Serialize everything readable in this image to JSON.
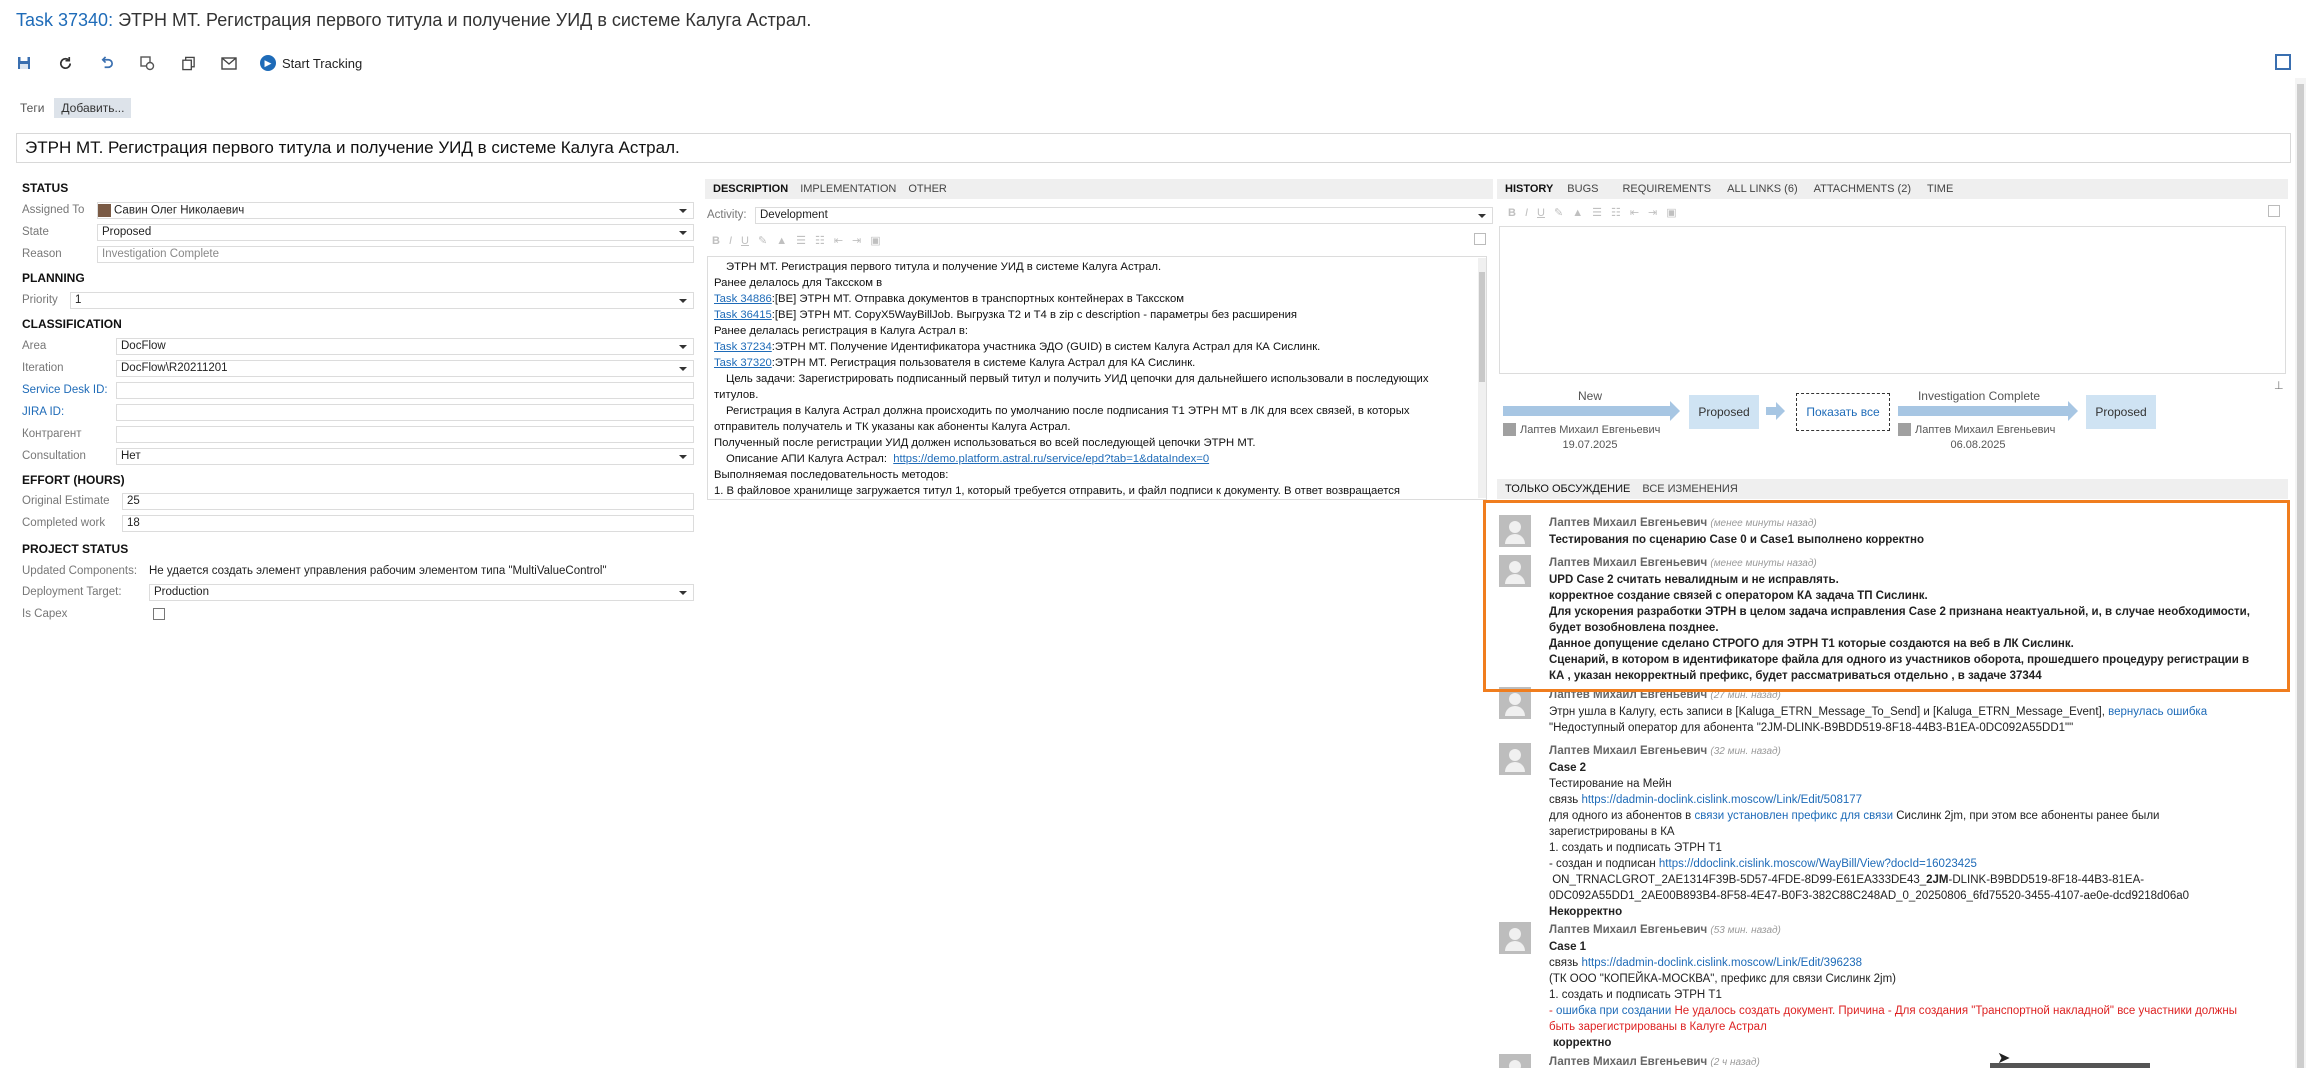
{
  "title": {
    "id": "Task 37340:",
    "text": "ЭТРН МТ. Регистрация первого титула и получение УИД в системе Калуга Астрал."
  },
  "toolbar": {
    "start_tracking": "Start Tracking"
  },
  "tags": {
    "label": "Теги",
    "add": "Добавить..."
  },
  "work_item_title": "ЭТРН МТ. Регистрация первого титула и получение УИД в системе Калуга Астрал.",
  "status": {
    "heading": "STATUS",
    "assigned_to_label": "Assigned To",
    "assigned_to": "Савин Олег Николаевич",
    "state_label": "State",
    "state": "Proposed",
    "reason_label": "Reason",
    "reason": "Investigation Complete"
  },
  "planning": {
    "heading": "PLANNING",
    "priority_label": "Priority",
    "priority": "1"
  },
  "classification": {
    "heading": "CLASSIFICATION",
    "area_label": "Area",
    "area": "DocFlow",
    "iteration_label": "Iteration",
    "iteration": "DocFlow\\R20211201",
    "service_desk_label": "Service Desk ID:",
    "service_desk": "",
    "jira_label": "JIRA ID:",
    "jira": "",
    "counterparty_label": "Контрагент",
    "counterparty": "",
    "consultation_label": "Consultation",
    "consultation": "Нет"
  },
  "effort": {
    "heading": "EFFORT (HOURS)",
    "original_label": "Original Estimate",
    "original": "25",
    "completed_label": "Completed work",
    "completed": "18"
  },
  "project_status": {
    "heading": "PROJECT STATUS",
    "updated_label": "Updated Components:",
    "updated": "Не удается создать элемент управления рабочим элементом типа \"MultiValueControl\"",
    "deployment_label": "Deployment Target:",
    "deployment": "Production",
    "capex_label": "Is Capex"
  },
  "desc_tabs": [
    "DESCRIPTION",
    "IMPLEMENTATION",
    "OTHER"
  ],
  "activity": {
    "label": "Activity:",
    "value": "Development"
  },
  "description": {
    "l1": "ЭТРН МТ. Регистрация первого титула и получение УИД в системе Калуга Астрал.",
    "l2": "Ранее делалось для Таксском в",
    "l3_link": "Task 34886",
    "l3": ":[ВЕ] ЭТРН МТ. Отправка документов в транспортных контейнерах в Таксском",
    "l4_link": "Task 36415",
    "l4": ":[ВЕ] ЭТРН МТ. CopyX5WayBillJob. Выгрузка Т2 и Т4 в zip с description - параметры без расширения",
    "l5": "Ранее делалась регистрация в Калуга Астрал в:",
    "l6_link": "Task 37234",
    "l6": ":ЭТРН МТ. Получение Идентификатора участника ЭДО (GUID) в систем Калуга Астрал для КА Сислинк.",
    "l7_link": "Task 37320",
    "l7": ":ЭТРН МТ. Регистрация пользователя в системе Калуга Астрал для КА Сислинк.",
    "l8": "Цель задачи: Зарегистрировать подписанный первый титул и получить УИД цепочки для дальнейшего использовали в последующих",
    "l9": "титулов.",
    "l10": "Регистрация в Калуга Астрал должна происходить по умолчанию после подписания Т1 ЭТРН МТ в ЛК для всех связей, в которых",
    "l11": "отправитель получатель и ТК указаны как абоненты Калуга Астрал.",
    "l12": "Полученный после регистрации УИД должен использоваться во всей последующей цепочки ЭТРН МТ.",
    "l13": "Описание АПИ Калуга Астрал:",
    "l13_link": "https://demo.platform.astral.ru/service/epd?tab=1&dataIndex=0",
    "l14": "Выполняемая последовательность методов:",
    "l15": "1. В файловое хранилище загружается титул 1, который требуется отправить, и файл подписи к документу. В ответ возвращается"
  },
  "right_tabs": [
    "HISTORY",
    "BUGS",
    "REQUIREMENTS",
    "ALL LINKS (6)",
    "ATTACHMENTS (2)",
    "TIME"
  ],
  "workflow": {
    "s1_label": "New",
    "s1_user": "Лаптев Михаил Евгеньевич",
    "s1_date": "19.07.2025",
    "box1": "Proposed",
    "show_all": "Показать все",
    "s2_label": "Investigation Complete",
    "s2_user": "Лаптев Михаил Евгеньевич",
    "s2_date": "06.08.2025",
    "box2": "Proposed"
  },
  "disc_tabs": [
    "ТОЛЬКО ОБСУЖДЕНИЕ",
    "ВСЕ ИЗМЕНЕНИЯ"
  ],
  "comments": {
    "author": "Лаптев Михаил Евгеньевич",
    "c1_time": "(менее минуты назад)",
    "c1": "Тестирования по сценарию Case 0 и Case1 выполнено корректно",
    "c2_time": "(менее минуты назад)",
    "c2_l1": "UPD Case 2 считать невалидным и не исправлять.",
    "c2_l2": "корректное создание связей с оператором КА задача ТП Сислинк.",
    "c2_l3": "Для ускорения разработки ЭТРН в целом задача исправления Case 2 признана неактуальной, и, в случае необходимости,",
    "c2_l4": "будет возобновлена позднее.",
    "c2_l5": "Данное допущение сделано СТРОГО для ЭТРН Т1 которые создаются на веб в ЛК Сислинк.",
    "c2_l6": "Сценарий, в котором в идентификаторе файла для одного из участников оборота, прошедшего процедуру регистрации в",
    "c2_l7": "КА , указан некорректный префикс, будет рассматриваться отдельно , в задаче 37344",
    "c3_time": "(27 мин. назад)",
    "c3_l1": "Этрн ушла в Калугу, есть записи в [Kaluga_ETRN_Message_To_Send] и [Kaluga_ETRN_Message_Event],",
    "c3_l1_link": "вернулась ошибка",
    "c3_l2": "\"Недоступный оператор для абонента \"2JM-DLINK-B9BDD519-8F18-44B3-B1EA-0DC092A55DD1\"\"",
    "c4_time": "(32 мин. назад)",
    "c4_l1": "Case 2",
    "c4_l2": "Тестирование на Мейн",
    "c4_l3": "связь",
    "c4_l3_link": "https://dadmin-doclink.cislink.moscow/Link/Edit/508177",
    "c4_l4a": "для одного   из абонентов в",
    "c4_l4_link": "связи установлен префикс для связи",
    "c4_l4b": "Сислинк 2jm, при этом все абоненты ранее были",
    "c4_l5": "зарегистрированы в КА",
    "c4_l6": "1. создать и подписать ЭТРН Т1",
    "c4_l7a": "- создан и подписан",
    "c4_l7_link": "https://ddoclink.cislink.moscow/WayBill/View?docId=16023425",
    "c4_l8a": "ON_TRNACLGROT_2AE1314F39B-5D57-4FDE-8D99-E61EA333DE43_",
    "c4_l8b": "2JM",
    "c4_l8c": "-DLINK-B9BDD519-8F18-44B3-81EA-",
    "c4_l9": "0DC092A55DD1_2AE00B893B4-8F58-4E47-B0F3-382C88C248AD_0_20250806_6fd75520-3455-4107-ae0e-dcd9218d06a0",
    "c4_l10": "Некорректно",
    "c5_time": "(53 мин. назад)",
    "c5_l1": "Case 1",
    "c5_l2": "связь",
    "c5_l2_link": "https://dadmin-doclink.cislink.moscow/Link/Edit/396238",
    "c5_l3": "(ТК ООО \"КОПЕЙКА-МОСКВА\",  префикс для связи Сислинк 2jm)",
    "c5_l4": "1. создать и подписать ЭТРН Т1",
    "c5_l5a": "-",
    "c5_l5_link": "ошибка при создании",
    "c5_l5b": "Не удалось создать документ. Причина - Для создания \"Транспортной накладной\" все участники должны",
    "c5_l6": "быть зарегистрированы в Калуге Астрал",
    "c5_l7": "корректно",
    "c6_time": "(2 ч назад)"
  },
  "colors": {
    "accent": "#1e6bb8",
    "highlight": "#f07d1e",
    "workflow_box": "#cfe3f3"
  }
}
